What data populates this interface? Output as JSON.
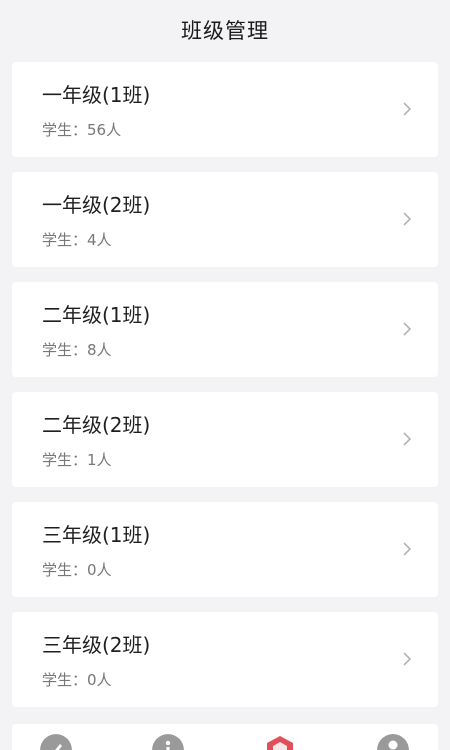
{
  "header": {
    "title": "班级管理"
  },
  "classes": [
    {
      "name": "一年级(1班)",
      "students": "学生：56人"
    },
    {
      "name": "一年级(2班)",
      "students": "学生：4人"
    },
    {
      "name": "二年级(1班)",
      "students": "学生：8人"
    },
    {
      "name": "二年级(2班)",
      "students": "学生：1人"
    },
    {
      "name": "三年级(1班)",
      "students": "学生：0人"
    },
    {
      "name": "三年级(2班)",
      "students": "学生：0人"
    }
  ],
  "icons": {
    "row_arrow": "chevron-right-icon",
    "tabs": [
      "pencil-icon",
      "info-icon",
      "class-icon",
      "user-icon"
    ]
  },
  "colors": {
    "background": "#f3f3f5",
    "card": "#ffffff",
    "tab_inactive": "#9a9a9a",
    "tab_active": "#e0505a"
  }
}
